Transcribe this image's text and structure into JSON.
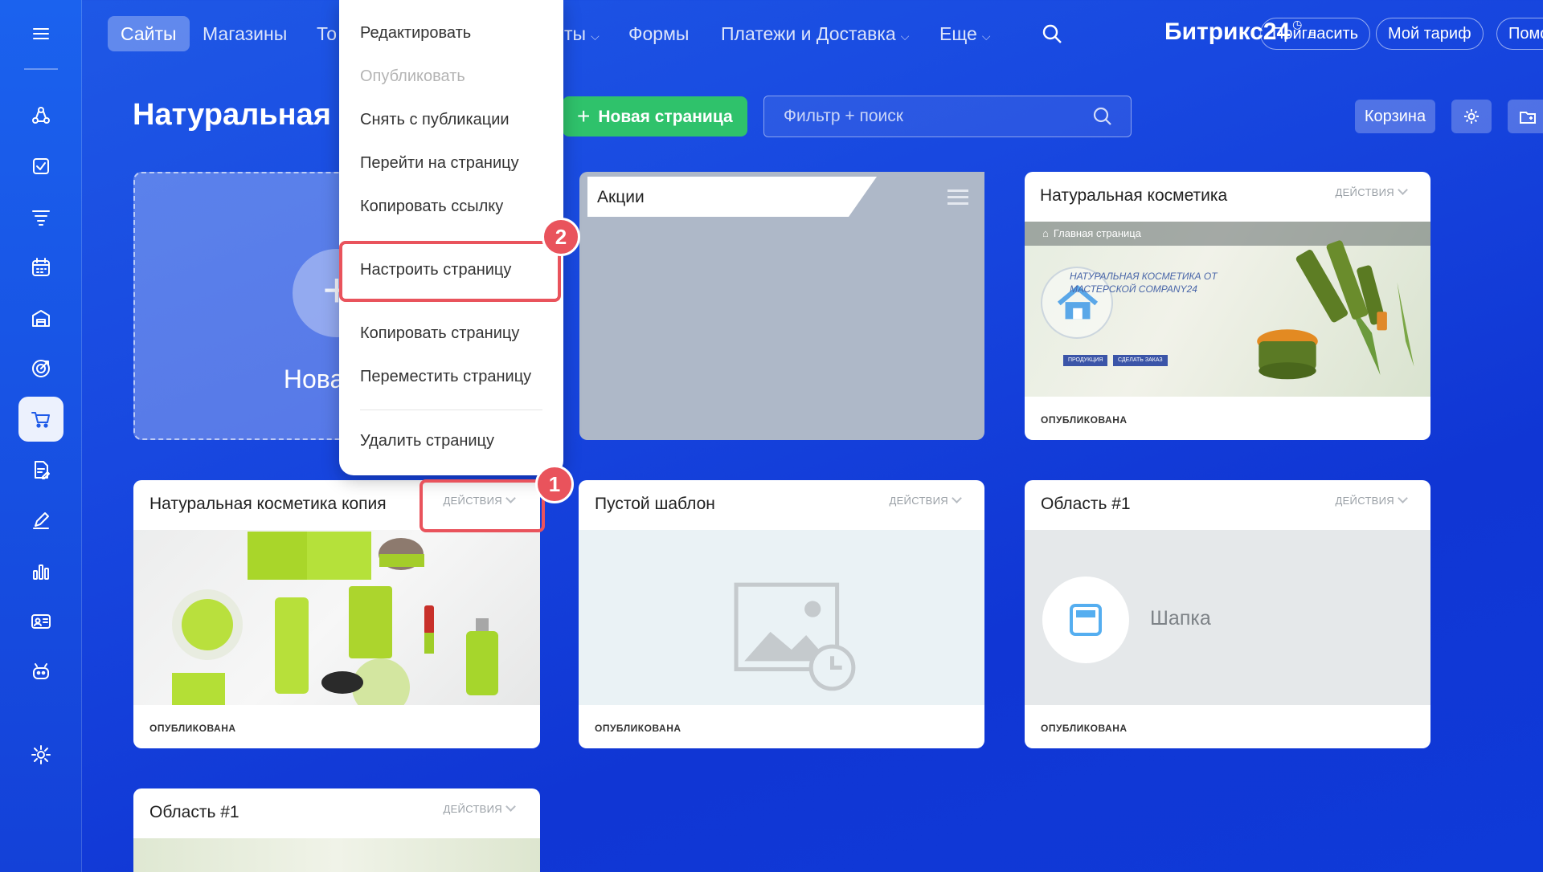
{
  "nav": {
    "items": [
      {
        "label": "Сайты",
        "active": true
      },
      {
        "label": "Магазины"
      },
      {
        "label": "То"
      },
      {
        "label": "ты"
      },
      {
        "label": "Формы"
      },
      {
        "label": "Платежи и Доставка"
      },
      {
        "label": "Еще"
      }
    ],
    "brand": "Битрикс24",
    "invite": "Пригласить",
    "tariff": "Мой тариф",
    "help": "Помо"
  },
  "sidebar": {
    "icons": [
      "menu-icon",
      "crm-icon",
      "tasks-icon",
      "funnel-icon",
      "calendar-icon",
      "store-icon",
      "target-icon",
      "cart-icon",
      "document-icon",
      "pen-icon",
      "analytics-icon",
      "contact-card-icon",
      "robot-icon",
      "settings-icon"
    ],
    "active": "cart-icon"
  },
  "header": {
    "title": "Натуральная к",
    "new_page": "Новая страница",
    "search_placeholder": "Фильтр + поиск",
    "trash": "Корзина"
  },
  "cards": {
    "new_card_label": "Новая ст",
    "folder_title": "Акции",
    "actions_label": "ДЕЙСТВИЯ",
    "items": [
      {
        "title": "Натуральная косметика",
        "status": "ОПУБЛИКОВАНА",
        "preview_breadcrumb": "Главная страница",
        "preview_heading": "НАТУРАЛЬНАЯ КОСМЕТИКА ОТ МАСТЕРСКОЙ COMPANY24",
        "preview_btn1": "ПРОДУКЦИЯ",
        "preview_btn2": "СДЕЛАТЬ ЗАКАЗ"
      },
      {
        "title": "Натуральная косметика копия",
        "status": "ОПУБЛИКОВАНА"
      },
      {
        "title": "Пустой шаблон",
        "status": "ОПУБЛИКОВАНА"
      },
      {
        "title": "Область #1",
        "status": "ОПУБЛИКОВАНА",
        "block_label": "Шапка"
      },
      {
        "title": "Область #1"
      }
    ]
  },
  "menu": {
    "items": [
      {
        "label": "Редактировать",
        "disabled": false
      },
      {
        "label": "Опубликовать",
        "disabled": true
      },
      {
        "label": "Снять с публикации",
        "disabled": false
      },
      {
        "label": "Перейти на страницу",
        "disabled": false
      },
      {
        "label": "Копировать ссылку",
        "disabled": false
      },
      {
        "label": "Настроить страницу",
        "disabled": false,
        "highlighted": true
      },
      {
        "label": "Копировать страницу",
        "disabled": false
      },
      {
        "label": "Переместить страницу",
        "disabled": false
      },
      {
        "label": "Удалить страницу",
        "disabled": false
      }
    ]
  },
  "badges": {
    "first": "1",
    "second": "2"
  },
  "colors": {
    "accent": "#2fc26b",
    "highlight": "#e9535c",
    "background": "#1848e0"
  }
}
